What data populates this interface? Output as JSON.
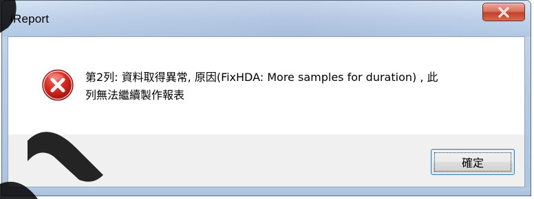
{
  "window": {
    "title": "iReport"
  },
  "titlebar": {
    "close_icon": "close-x-icon"
  },
  "dialog": {
    "icon": "error-icon",
    "message_line1": "第2列: 資料取得異常, 原因(FixHDA: More samples for duration) , 此",
    "message_line2": "列無法繼續製作報表",
    "ok_label": "確定"
  },
  "colors": {
    "error_red": "#c8201b",
    "close_button": "#c8452d",
    "button_border": "#3c7fb1"
  }
}
